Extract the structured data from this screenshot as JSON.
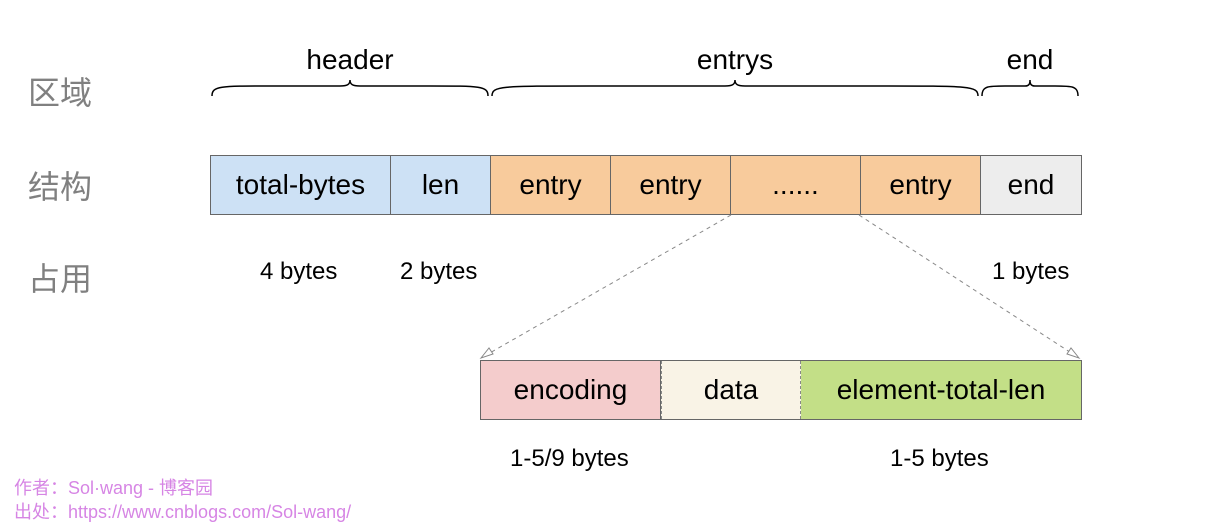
{
  "labels": {
    "region": "区域",
    "structure": "结构",
    "usage": "占用"
  },
  "regions": {
    "header": "header",
    "entrys": "entrys",
    "end": "end"
  },
  "structure": {
    "total_bytes": "total-bytes",
    "len": "len",
    "entry1": "entry",
    "entry2": "entry",
    "ellipsis": "......",
    "entry3": "entry",
    "end": "end"
  },
  "sizes": {
    "total_bytes": "4 bytes",
    "len": "2 bytes",
    "end": "1 bytes",
    "encoding": "1-5/9 bytes",
    "element_total_len": "1-5 bytes"
  },
  "entry_detail": {
    "encoding": "encoding",
    "data": "data",
    "element_total_len": "element-total-len"
  },
  "watermark": {
    "author_label": "作者：",
    "author": "Sol·wang - 博客园",
    "source_label": "出处：",
    "source": "https://www.cnblogs.com/Sol-wang/"
  }
}
